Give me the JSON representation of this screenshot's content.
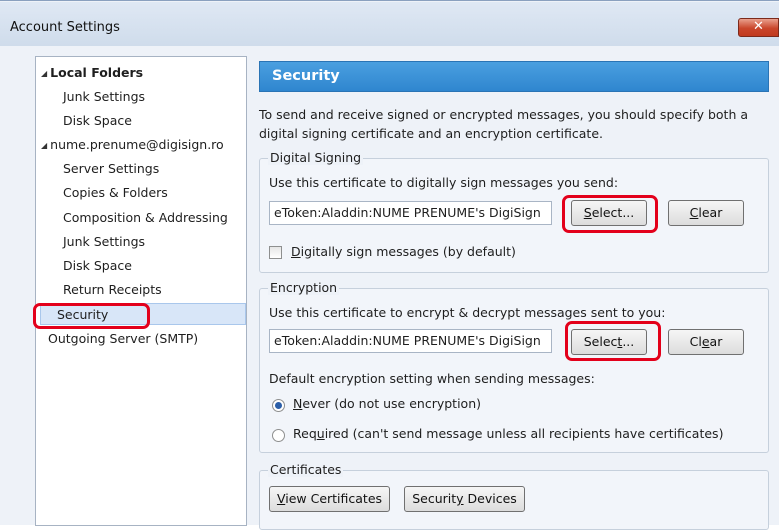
{
  "window": {
    "title": "Account Settings",
    "close_glyph": "✕"
  },
  "tree": {
    "local_folders": {
      "label": "Local Folders",
      "junk": "Junk Settings",
      "disk": "Disk Space"
    },
    "account": {
      "label": "nume.prenume@digisign.ro",
      "server": "Server Settings",
      "copies": "Copies & Folders",
      "composition": "Composition & Addressing",
      "junk": "Junk Settings",
      "disk": "Disk Space",
      "receipts": "Return Receipts",
      "security": "Security"
    },
    "outgoing": "Outgoing Server (SMTP)",
    "selected": "Security"
  },
  "security": {
    "header": "Security",
    "intro_line1": "To send and receive signed or encrypted messages, you should specify both a",
    "intro_line2": "digital signing certificate and an encryption certificate."
  },
  "signing": {
    "group": "Digital Signing",
    "instruction": "Use this certificate to digitally sign messages you send:",
    "cert_value": "eToken:Aladdin:NUME PRENUME's DigiSign",
    "select_label": {
      "pre": "",
      "key": "S",
      "post": "elect..."
    },
    "clear_label": {
      "pre": "",
      "key": "C",
      "post": "lear"
    },
    "checkbox_label": {
      "pre": "",
      "key": "D",
      "post": "igitally sign messages (by default)"
    },
    "checked": false
  },
  "encryption": {
    "group": "Encryption",
    "instruction": "Use this certificate to encrypt & decrypt messages sent to you:",
    "cert_value": "eToken:Aladdin:NUME PRENUME's DigiSign",
    "select_label": {
      "pre": "Selec",
      "key": "t",
      "post": "..."
    },
    "clear_label": {
      "pre": "Cl",
      "key": "e",
      "post": "ar"
    },
    "default_label": "Default encryption setting when sending messages:",
    "never": {
      "pre": "",
      "key": "N",
      "post": "ever (do not use encryption)"
    },
    "required": {
      "pre": "Req",
      "key": "u",
      "post": "ired (can't send message unless all recipients have certificates)"
    },
    "selected_option": "never"
  },
  "certificates": {
    "group": "Certificates",
    "view": {
      "pre": "",
      "key": "V",
      "post": "iew Certificates"
    },
    "devices": {
      "pre": "Securit",
      "key": "y",
      "post": " Devices"
    }
  },
  "colors": {
    "accent": "#2f86cf",
    "highlight": "#e3001b",
    "selection": "#d8e6f8"
  },
  "icons": {
    "expand": "triangle-expanded-icon",
    "close": "close-icon"
  }
}
